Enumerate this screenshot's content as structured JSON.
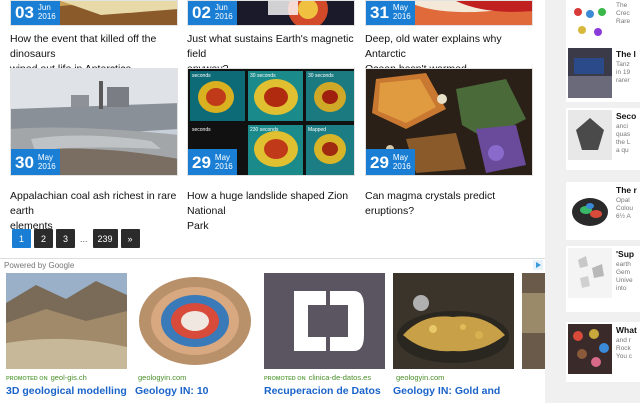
{
  "articles_top": [
    {
      "day": "03",
      "month": "Jun",
      "year": "2016",
      "title_lines": [
        "How the event that killed off the dinosaurs",
        "wiped out life in Antarctica"
      ]
    },
    {
      "day": "02",
      "month": "Jun",
      "year": "2016",
      "title_lines": [
        "Just what sustains Earth's magnetic field",
        "anyway?"
      ]
    },
    {
      "day": "31",
      "month": "May",
      "year": "2016",
      "title_lines": [
        "Deep, old water explains why Antarctic",
        "Ocean hasn't warmed"
      ]
    }
  ],
  "articles_bottom": [
    {
      "day": "30",
      "month": "May",
      "year": "2016",
      "title_lines": [
        "Appalachian coal ash richest in rare earth",
        "elements"
      ]
    },
    {
      "day": "29",
      "month": "May",
      "year": "2016",
      "title_lines": [
        "How a huge landslide shaped Zion National",
        "Park"
      ]
    },
    {
      "day": "29",
      "month": "May",
      "year": "2016",
      "title_lines": [
        "Can magma crystals predict eruptions?",
        ""
      ]
    }
  ],
  "magma_image_labels": [
    "seconds",
    "30 seconds",
    "30 seconds",
    "seconds",
    "230 seconds",
    "Mapped"
  ],
  "pagination": {
    "pages": [
      "1",
      "2",
      "3"
    ],
    "ellipsis": "...",
    "last": "239",
    "next": "»",
    "active": "1"
  },
  "ads": {
    "powered_by": "Powered by Google",
    "items": [
      {
        "promo": "PROMOTED ON",
        "source": "geol-gis.ch",
        "headline": "3D geological modelling"
      },
      {
        "promo": "",
        "source": "geologyin.com",
        "headline": "Geology IN: 10"
      },
      {
        "promo": "PROMOTED ON",
        "source": "clinica-de-datos.es",
        "headline": "Recuperacion de Datos"
      },
      {
        "promo": "",
        "source": "geologyin.com",
        "headline": "Geology IN: Gold and"
      }
    ]
  },
  "sidebar": [
    {
      "title": "",
      "lines": [
        "The",
        "Crec",
        "Rare"
      ]
    },
    {
      "title": "The l",
      "lines": [
        "Tanz",
        "in 19",
        "rarer"
      ]
    },
    {
      "title": "Seco",
      "lines": [
        "anci",
        "quas",
        "the L",
        "a qu"
      ]
    },
    {
      "title": "The r",
      "lines": [
        "Opal",
        "Colou",
        "6½ A"
      ]
    },
    {
      "title": "'Sup",
      "lines": [
        "earth",
        "Gem",
        "Unive",
        "into"
      ]
    },
    {
      "title": "What",
      "lines": [
        "and r",
        "Rock",
        "You c"
      ]
    }
  ]
}
